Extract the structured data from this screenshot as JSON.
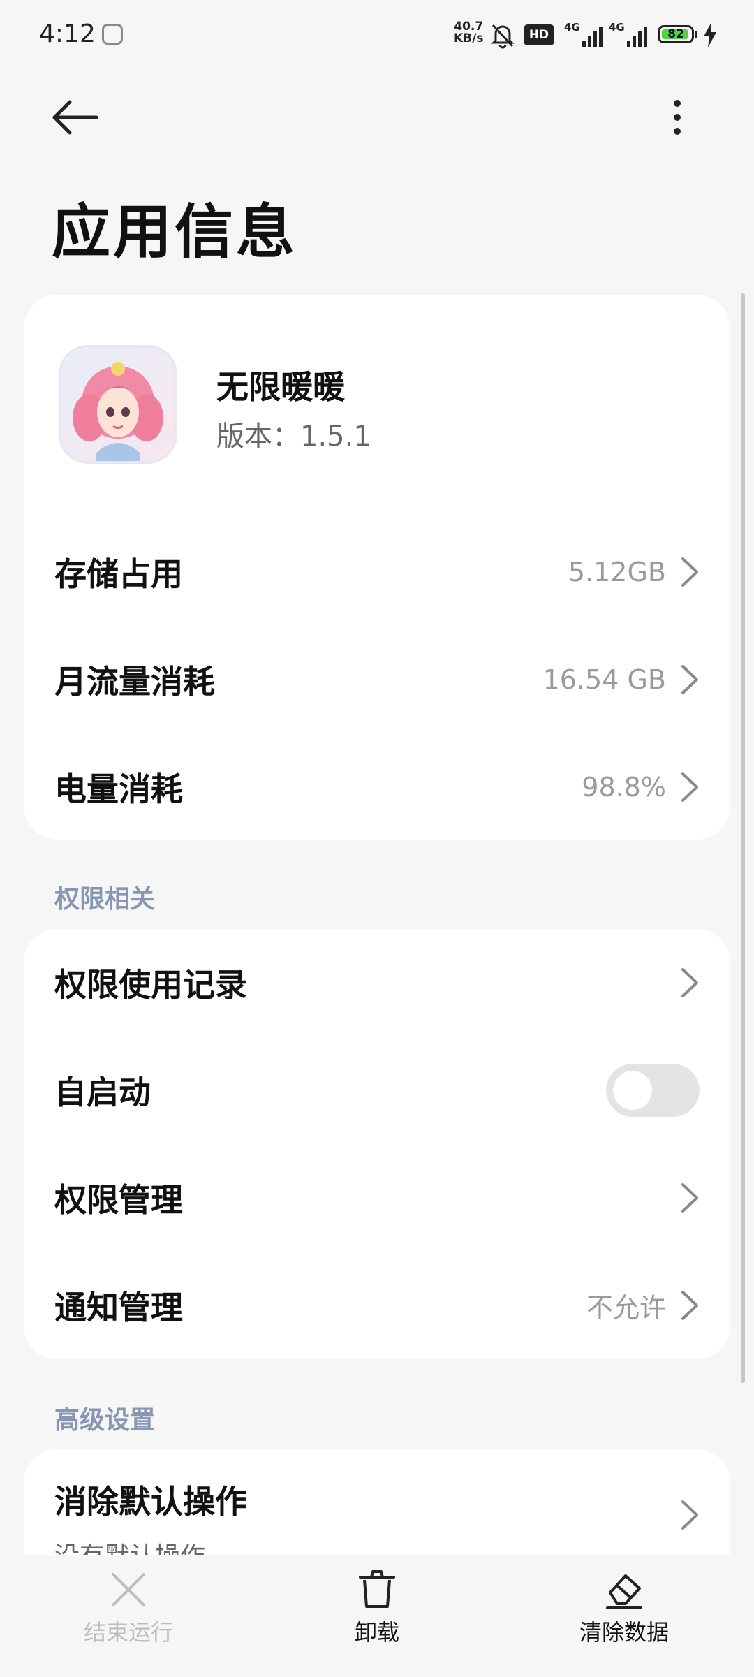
{
  "status_bar": {
    "time": "4:12",
    "net_speed_value": "40.7",
    "net_speed_unit": "KB/s",
    "hd_label": "HD",
    "signal1_label": "4G",
    "signal2_label": "4G",
    "battery_level": "82",
    "icons": [
      "app-notification-icon",
      "bell-off-icon",
      "hd-icon",
      "signal-icon",
      "signal-icon",
      "battery-icon",
      "charging-icon"
    ]
  },
  "header": {
    "title": "应用信息",
    "back_icon": "arrow-left-icon",
    "more_icon": "more-vertical-icon"
  },
  "app": {
    "name": "无限暖暖",
    "version": "版本：1.5.1"
  },
  "usage": [
    {
      "label": "存储占用",
      "value": "5.12GB"
    },
    {
      "label": "月流量消耗",
      "value": "16.54 GB"
    },
    {
      "label": "电量消耗",
      "value": "98.8%"
    }
  ],
  "permissions": {
    "section_title": "权限相关",
    "items": [
      {
        "label": "权限使用记录",
        "value": ""
      },
      {
        "label": "自启动",
        "toggle": false
      },
      {
        "label": "权限管理",
        "value": ""
      },
      {
        "label": "通知管理",
        "value": "不允许"
      }
    ]
  },
  "advanced": {
    "section_title": "高级设置",
    "items": [
      {
        "label": "消除默认操作",
        "sublabel": "没有默认操作"
      }
    ]
  },
  "bottom_bar": {
    "items": [
      {
        "label": "结束运行",
        "icon": "close-icon",
        "enabled": false
      },
      {
        "label": "卸载",
        "icon": "trash-icon",
        "enabled": true
      },
      {
        "label": "清除数据",
        "icon": "eraser-icon",
        "enabled": true
      }
    ]
  },
  "colors": {
    "background": "#f6f6f6",
    "card": "#ffffff",
    "section_title": "#8896b3",
    "secondary_text": "#9a9a9a",
    "toggle_off": "#e4e4e4",
    "battery_green": "#4cd63f"
  }
}
